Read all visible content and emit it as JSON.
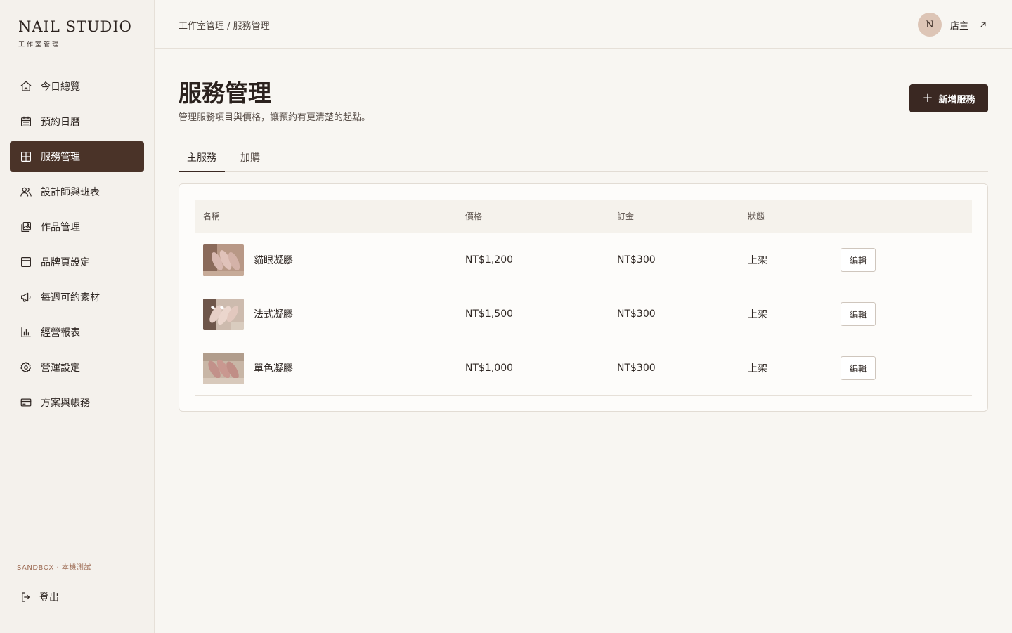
{
  "brand": {
    "title": "NAIL STUDIO",
    "subtitle": "工作室管理"
  },
  "nav": {
    "items": [
      {
        "label": "今日總覽",
        "icon": "home-icon"
      },
      {
        "label": "預約日曆",
        "icon": "calendar-icon"
      },
      {
        "label": "服務管理",
        "icon": "grid-icon",
        "active": true
      },
      {
        "label": "設計師與班表",
        "icon": "users-icon"
      },
      {
        "label": "作品管理",
        "icon": "gallery-icon"
      },
      {
        "label": "品牌頁設定",
        "icon": "layout-icon"
      },
      {
        "label": "每週可約素材",
        "icon": "megaphone-icon"
      },
      {
        "label": "經營報表",
        "icon": "bar-chart-icon"
      },
      {
        "label": "營運設定",
        "icon": "gear-icon"
      },
      {
        "label": "方案與帳務",
        "icon": "credit-card-icon"
      }
    ],
    "sandbox": "SANDBOX · 本機測試",
    "logout": "登出"
  },
  "header": {
    "breadcrumb": "工作室管理 / 服務管理",
    "avatar_initial": "N",
    "user_name": "店主"
  },
  "page": {
    "title": "服務管理",
    "description": "管理服務項目與價格，讓預約有更清楚的起點。",
    "add_button": "新增服務",
    "tabs": [
      {
        "label": "主服務",
        "active": true
      },
      {
        "label": "加購"
      }
    ]
  },
  "table": {
    "columns": {
      "name": "名稱",
      "price": "價格",
      "deposit": "訂金",
      "status": "狀態"
    },
    "edit_label": "編輯",
    "rows": [
      {
        "name": "貓眼凝膠",
        "price": "NT$1,200",
        "deposit": "NT$300",
        "status": "上架"
      },
      {
        "name": "法式凝膠",
        "price": "NT$1,500",
        "deposit": "NT$300",
        "status": "上架"
      },
      {
        "name": "單色凝膠",
        "price": "NT$1,000",
        "deposit": "NT$300",
        "status": "上架"
      }
    ]
  },
  "colors": {
    "accent": "#4a3328",
    "button_dark": "#3a2822",
    "background": "#f8f6f2",
    "sidebar_bg": "#f4f1ec",
    "avatar_bg": "#ddc5b6",
    "sandbox_text": "#9c6a52"
  }
}
